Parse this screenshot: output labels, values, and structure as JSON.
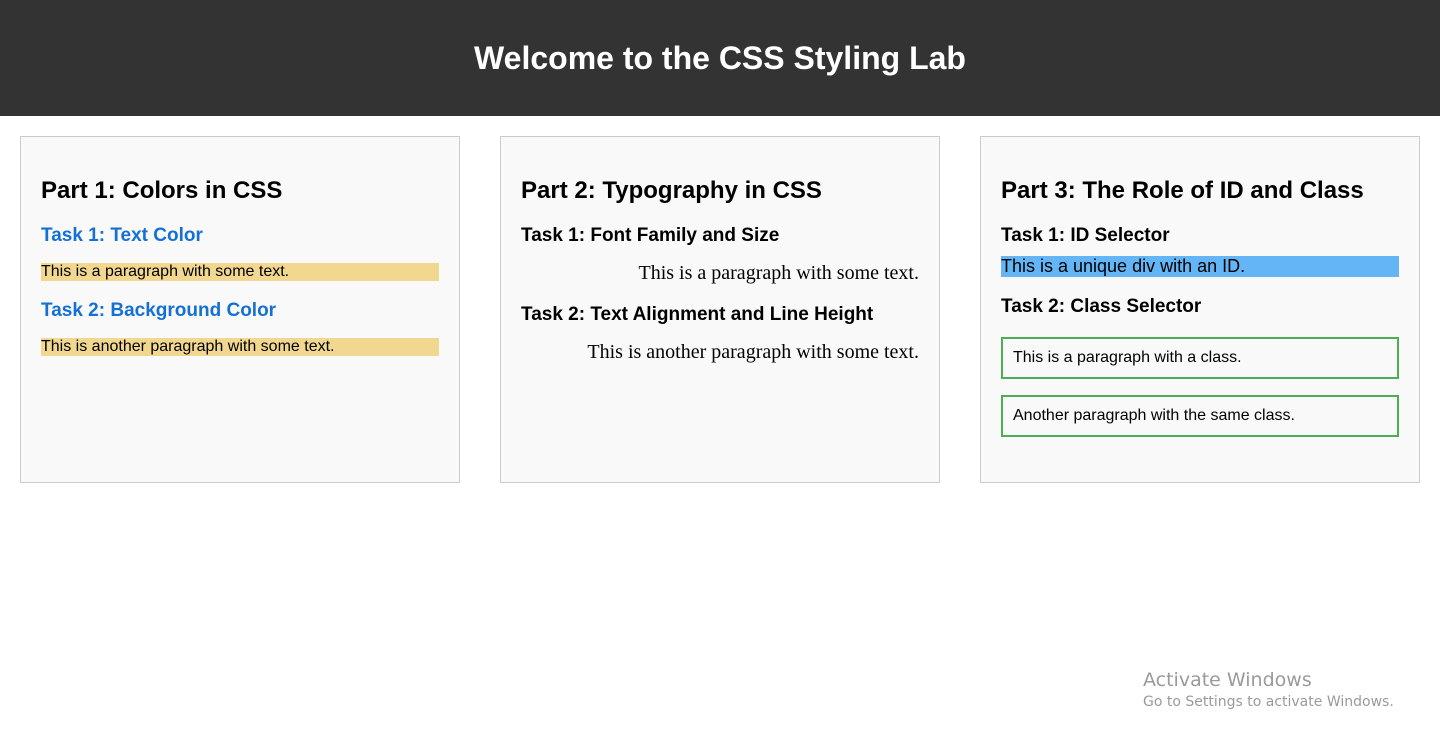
{
  "header": {
    "title": "Welcome to the CSS Styling Lab"
  },
  "sections": [
    {
      "title": "Part 1: Colors in CSS",
      "task1": "Task 1: Text Color",
      "p1": "This is a paragraph with some text.",
      "task2": "Task 2: Background Color",
      "p2": "This is another paragraph with some text."
    },
    {
      "title": "Part 2: Typography in CSS",
      "task1": "Task 1: Font Family and Size",
      "p1": "This is a paragraph with some text.",
      "task2": "Task 2: Text Alignment and Line Height",
      "p2": "This is another paragraph with some text."
    },
    {
      "title": "Part 3: The Role of ID and Class",
      "task1": "Task 1: ID Selector",
      "unique_div": "This is a unique div with an ID.",
      "task2": "Task 2: Class Selector",
      "p1": "This is a paragraph with a class.",
      "p2": "Another paragraph with the same class."
    }
  ],
  "watermark": {
    "title": "Activate Windows",
    "subtitle": "Go to Settings to activate Windows."
  },
  "colors": {
    "header_bg": "#333333",
    "card_bg": "#f9f9f9",
    "task_blue": "#1570d6",
    "highlight_yellow": "#f1d78f",
    "id_blue": "#64b5f6",
    "class_border_green": "#4caf50"
  }
}
